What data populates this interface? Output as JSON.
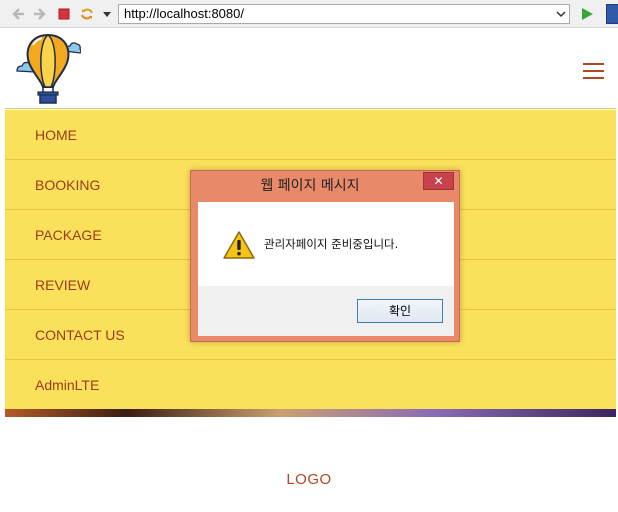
{
  "browser": {
    "url": "http://localhost:8080/",
    "icons": [
      "back-arrow-icon",
      "forward-arrow-icon",
      "stop-icon",
      "refresh-icon",
      "dropdown-icon",
      "go-icon"
    ]
  },
  "site": {
    "nav": [
      {
        "label": "HOME"
      },
      {
        "label": "BOOKING"
      },
      {
        "label": "PACKAGE"
      },
      {
        "label": "REVIEW"
      },
      {
        "label": "CONTACT US"
      },
      {
        "label": "AdminLTE"
      }
    ],
    "footer_logo": "LOGO",
    "colors": {
      "menu_bg": "#fbe05c",
      "menu_text": "#9a3d14"
    }
  },
  "dialog": {
    "title": "웹 페이지 메시지",
    "close_glyph": "✕",
    "message": "관리자페이지 준비중입니다.",
    "ok_label": "확인",
    "icon": "warning-icon"
  }
}
